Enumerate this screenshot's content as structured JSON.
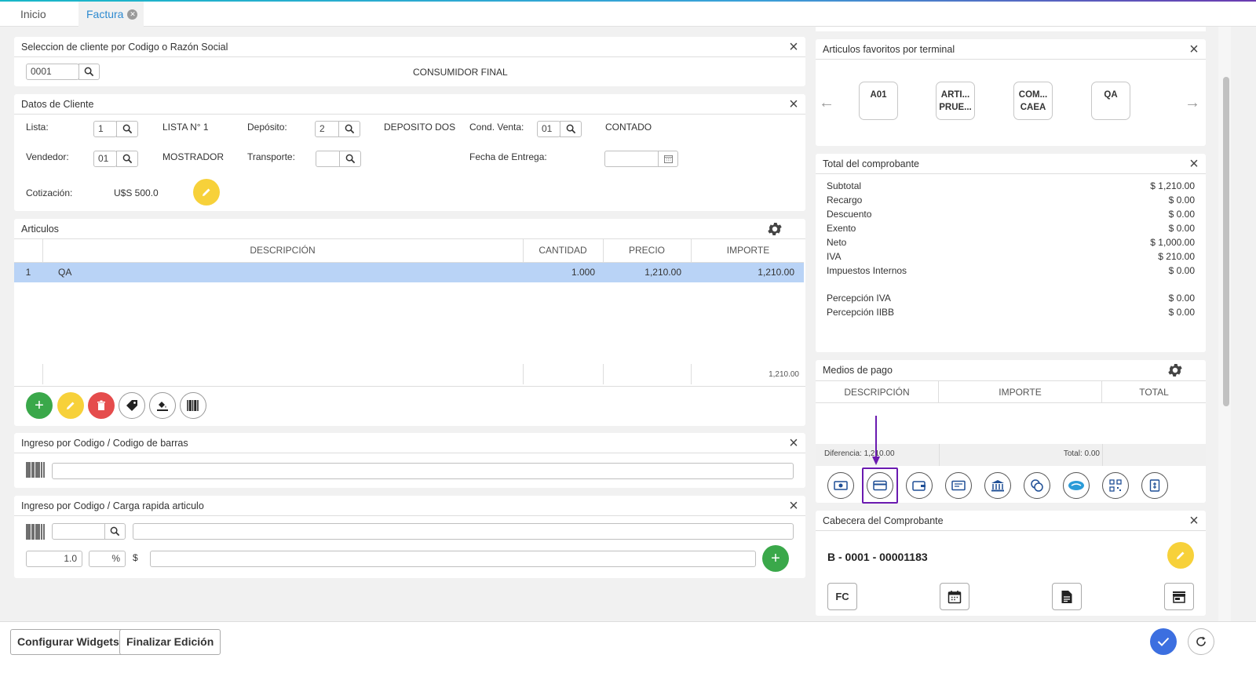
{
  "tabs": [
    {
      "label": "Inicio"
    },
    {
      "label": "Factura"
    }
  ],
  "cliente": {
    "title": "Seleccion de cliente por Codigo o Razón Social",
    "code": "0001",
    "name": "CONSUMIDOR FINAL"
  },
  "datos": {
    "title": "Datos de Cliente",
    "lista_label": "Lista:",
    "lista_val": "1",
    "lista_name": "LISTA N° 1",
    "deposito_label": "Depósito:",
    "deposito_val": "2",
    "deposito_name": "DEPOSITO DOS",
    "cond_label": "Cond. Venta:",
    "cond_val": "01",
    "cond_name": "CONTADO",
    "vendedor_label": "Vendedor:",
    "vendedor_val": "01",
    "vendedor_name": "MOSTRADOR",
    "transporte_label": "Transporte:",
    "transporte_val": "",
    "fecha_label": "Fecha de Entrega:",
    "fecha_val": "",
    "cotiz_label": "Cotización:",
    "cotiz_val": "U$S 500.0"
  },
  "articulos": {
    "title": "Articulos",
    "headers": [
      "",
      "DESCRIPCIÓN",
      "CANTIDAD",
      "PRECIO",
      "IMPORTE"
    ],
    "rows": [
      {
        "n": "1",
        "desc": "QA",
        "cant": "1.000",
        "precio": "1,210.00",
        "importe": "1,210.00"
      }
    ],
    "footer_total": "1,210.00"
  },
  "barras": {
    "title": "Ingreso por Codigo / Codigo de barras",
    "value": ""
  },
  "rapida": {
    "title": "Ingreso por Codigo / Carga rapida articulo",
    "qty": "1.0",
    "pct": "%",
    "currency": "$"
  },
  "favoritos": {
    "title": "Articulos favoritos por terminal",
    "items": [
      {
        "l1": "A01",
        "l2": ""
      },
      {
        "l1": "ARTI...",
        "l2": "PRUE..."
      },
      {
        "l1": "COM...",
        "l2": "CAEA"
      },
      {
        "l1": "QA",
        "l2": ""
      }
    ]
  },
  "totales": {
    "title": "Total del comprobante",
    "rows": [
      {
        "label": "Subtotal",
        "value": "$ 1,210.00"
      },
      {
        "label": "Recargo",
        "value": "$ 0.00"
      },
      {
        "label": "Descuento",
        "value": "$ 0.00"
      },
      {
        "label": "Exento",
        "value": "$ 0.00"
      },
      {
        "label": "Neto",
        "value": "$ 1,000.00"
      },
      {
        "label": "IVA",
        "value": "$ 210.00"
      },
      {
        "label": "Impuestos Internos",
        "value": "$ 0.00"
      },
      {
        "label": "Percepción IVA",
        "value": "$ 0.00"
      },
      {
        "label": "Percepción IIBB",
        "value": "$ 0.00"
      }
    ]
  },
  "medios": {
    "title": "Medios de pago",
    "headers": [
      "DESCRIPCIÓN",
      "IMPORTE",
      "TOTAL"
    ],
    "diferencia": "Diferencia: 1,210.00",
    "total": "Total: 0.00"
  },
  "cabecera": {
    "title": "Cabecera del Comprobante",
    "numero": "B - 0001 - 00001183",
    "tipo": "FC"
  },
  "footer": {
    "configurar": "Configurar Widgets",
    "finalizar": "Finalizar Edición"
  },
  "colors": {
    "accent": "#2d8ad0",
    "green": "#3aa84a",
    "yellow": "#f7d13a",
    "red": "#e54c4c",
    "selected": "#b9d3f6",
    "highlight": "#6a1ab0",
    "confirm": "#3c6fe0"
  }
}
